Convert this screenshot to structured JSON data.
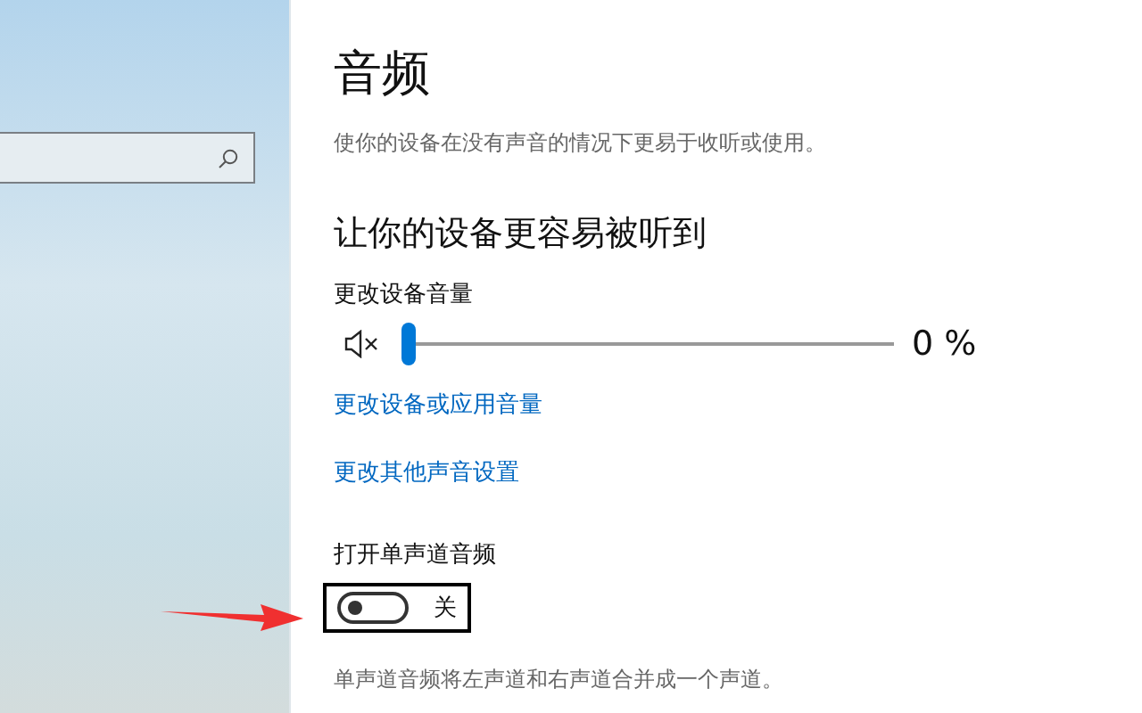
{
  "page": {
    "title": "音频",
    "subtitle": "使你的设备在没有声音的情况下更易于收听或使用。"
  },
  "section": {
    "heading": "让你的设备更容易被听到"
  },
  "volume": {
    "label": "更改设备音量",
    "muted": true,
    "level": 0,
    "reading": "0 %"
  },
  "links": [
    "更改设备或应用音量",
    "更改其他声音设置"
  ],
  "mono_audio": {
    "label": "打开单声道音频",
    "on": false,
    "state_text": "关",
    "highlighted": true,
    "description": "单声道音频将左声道和右声道合并成一个声道。"
  },
  "annotation": {
    "kind": "arrow"
  }
}
